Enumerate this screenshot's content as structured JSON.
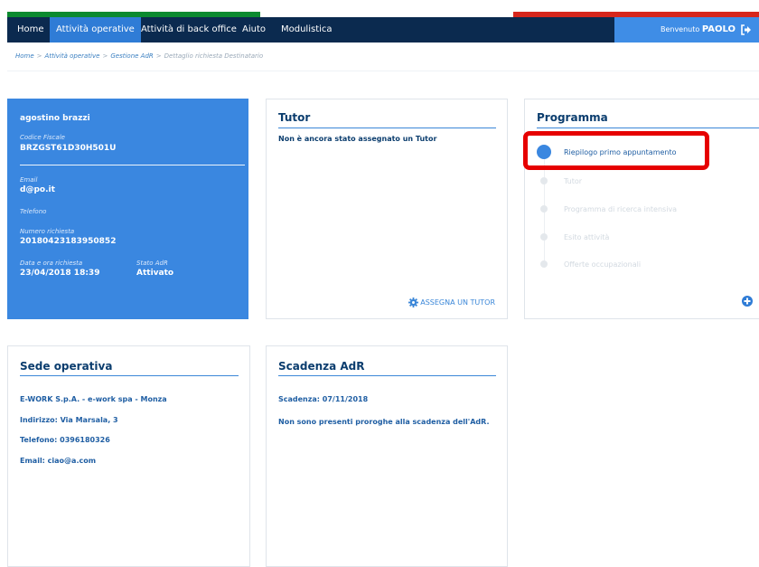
{
  "colors": {
    "navy": "#0b2a4f",
    "accent_blue": "#2f7cd6",
    "profile_blue": "#3a87e0",
    "flag_green": "#0b8a2f",
    "flag_red": "#d6261c",
    "highlight_red": "#e60000"
  },
  "nav": {
    "items": [
      "Home",
      "Attività operative",
      "Attività di back office",
      "Aiuto",
      "Modulistica"
    ],
    "active": "Attività operative",
    "welcome_prefix": "Benvenuto",
    "user": "PAOLO",
    "logout_icon": "sign-out-icon"
  },
  "breadcrumb": [
    "Home",
    "Attività operative",
    "Gestione AdR",
    "Dettaglio richiesta Destinatario"
  ],
  "profile": {
    "name": "agostino brazzi",
    "cf_label": "Codice Fiscale",
    "cf_value": "BRZGST61D30H501U",
    "email_label": "Email",
    "email_value": "d@po.it",
    "phone_label": "Telefono",
    "number_label": "Numero richiesta",
    "number_value": "20180423183950852",
    "date_label": "Data e ora richiesta",
    "date_value": "23/04/2018 18:39",
    "status_label": "Stato AdR",
    "status_value": "Attivato"
  },
  "tutor": {
    "title": "Tutor",
    "message": "Non è ancora stato assegnato un Tutor",
    "assign_label": "ASSEGNA UN TUTOR",
    "assign_icon": "gear-icon"
  },
  "programma": {
    "title": "Programma",
    "steps": [
      "Riepilogo primo appuntamento",
      "Tutor",
      "Programma di ricerca intensiva",
      "Esito attività",
      "Offerte occupazionali"
    ],
    "active_index": 0,
    "add_icon": "plus-circle-icon"
  },
  "sede": {
    "title": "Sede operativa",
    "lines": [
      "E-WORK S.p.A. - e-work spa - Monza",
      "Indirizzo: Via Marsala, 3",
      "Telefono: 0396180326",
      "Email: ciao@a.com"
    ]
  },
  "scadenza": {
    "title": "Scadenza AdR",
    "date_line": "Scadenza: 07/11/2018",
    "note": "Non sono presenti proroghe alla scadenza dell'AdR."
  }
}
